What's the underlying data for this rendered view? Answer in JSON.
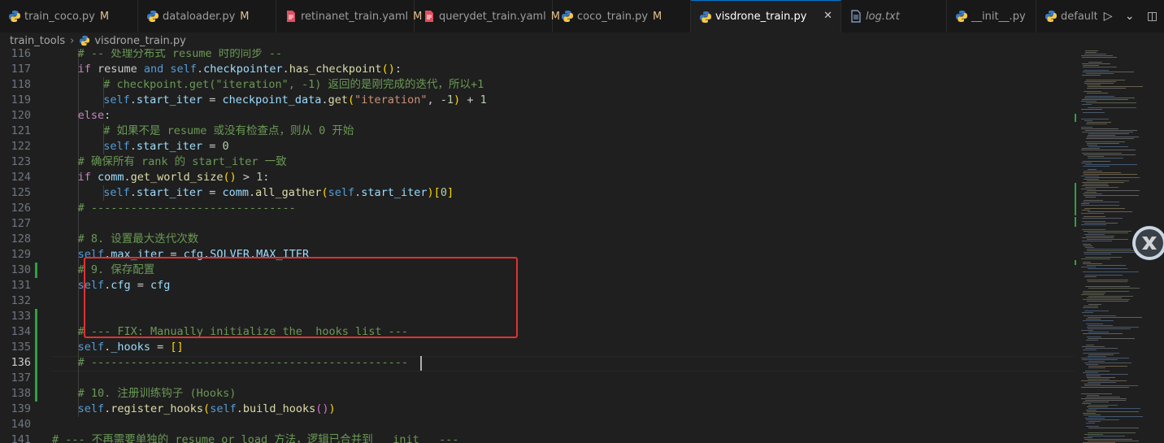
{
  "tabs": [
    {
      "label": "train_coco.py",
      "modified": "M",
      "icon": "python-icon",
      "active": false,
      "italic": false
    },
    {
      "label": "dataloader.py",
      "modified": "M",
      "icon": "python-icon",
      "active": false,
      "italic": false
    },
    {
      "label": "retinanet_train.yaml",
      "modified": "M",
      "icon": "yaml-icon",
      "active": false,
      "italic": false
    },
    {
      "label": "querydet_train.yaml",
      "modified": "M",
      "icon": "yaml-icon",
      "active": false,
      "italic": false
    },
    {
      "label": "coco_train.py",
      "modified": "M",
      "icon": "python-icon",
      "active": false,
      "italic": false
    },
    {
      "label": "visdrone_train.py",
      "modified": "",
      "icon": "python-icon",
      "active": true,
      "italic": false
    },
    {
      "label": "log.txt",
      "modified": "",
      "icon": "text-file-icon",
      "active": false,
      "italic": true
    },
    {
      "label": "__init__.py",
      "modified": "",
      "icon": "python-icon",
      "active": false,
      "italic": false
    },
    {
      "label": "defaults.",
      "modified": "",
      "icon": "python-icon",
      "active": false,
      "italic": false
    }
  ],
  "tab_actions": {
    "run": "▷",
    "run_menu": "⌄",
    "split": "◫"
  },
  "close_glyph": "✕",
  "breadcrumb": {
    "folder": "train_tools",
    "separator": "›",
    "file": "visdrone_train.py"
  },
  "colors": {
    "accent": "#0078d4",
    "modified": "#e2c08d",
    "git_added": "#2ea043",
    "highlight_box": "#e03131"
  },
  "lines": [
    {
      "n": "116",
      "gut": "",
      "tokens": [
        [
          "cm",
          "# -- 处理分布式 resume 时的同步 --"
        ]
      ]
    },
    {
      "n": "117",
      "gut": "",
      "tokens": [
        [
          "ctl",
          "if"
        ],
        [
          "pl",
          " resume "
        ],
        [
          "kw",
          "and"
        ],
        [
          "pl",
          " "
        ],
        [
          "kw",
          "self"
        ],
        [
          "pl",
          "."
        ],
        [
          "var",
          "checkpointer"
        ],
        [
          "pl",
          "."
        ],
        [
          "fn",
          "has_checkpoint"
        ],
        [
          "br1",
          "()"
        ],
        [
          "pl",
          ":"
        ]
      ]
    },
    {
      "n": "118",
      "gut": "",
      "tokens": [
        [
          "cm",
          "# checkpoint.get(\"iteration\", -1) 返回的是刚完成的迭代，所以+1"
        ]
      ]
    },
    {
      "n": "119",
      "gut": "",
      "tokens": [
        [
          "kw",
          "self"
        ],
        [
          "pl",
          "."
        ],
        [
          "var",
          "start_iter"
        ],
        [
          "pl",
          " = "
        ],
        [
          "var",
          "checkpoint_data"
        ],
        [
          "pl",
          "."
        ],
        [
          "fn",
          "get"
        ],
        [
          "br1",
          "("
        ],
        [
          "str",
          "\"iteration\""
        ],
        [
          "pl",
          ", -"
        ],
        [
          "num",
          "1"
        ],
        [
          "br1",
          ")"
        ],
        [
          "pl",
          " + "
        ],
        [
          "num",
          "1"
        ]
      ]
    },
    {
      "n": "120",
      "gut": "",
      "tokens": [
        [
          "ctl",
          "else"
        ],
        [
          "pl",
          ":"
        ]
      ]
    },
    {
      "n": "121",
      "gut": "",
      "tokens": [
        [
          "cm",
          "# 如果不是 resume 或没有检查点，则从 0 开始"
        ]
      ]
    },
    {
      "n": "122",
      "gut": "",
      "tokens": [
        [
          "kw",
          "self"
        ],
        [
          "pl",
          "."
        ],
        [
          "var",
          "start_iter"
        ],
        [
          "pl",
          " = "
        ],
        [
          "num",
          "0"
        ]
      ]
    },
    {
      "n": "123",
      "gut": "",
      "tokens": [
        [
          "cm",
          "# 确保所有 rank 的 start_iter 一致"
        ]
      ]
    },
    {
      "n": "124",
      "gut": "",
      "tokens": [
        [
          "ctl",
          "if"
        ],
        [
          "pl",
          " "
        ],
        [
          "var",
          "comm"
        ],
        [
          "pl",
          "."
        ],
        [
          "fn",
          "get_world_size"
        ],
        [
          "br1",
          "()"
        ],
        [
          "pl",
          " > "
        ],
        [
          "num",
          "1"
        ],
        [
          "pl",
          ":"
        ]
      ]
    },
    {
      "n": "125",
      "gut": "",
      "tokens": [
        [
          "kw",
          "self"
        ],
        [
          "pl",
          "."
        ],
        [
          "var",
          "start_iter"
        ],
        [
          "pl",
          " = "
        ],
        [
          "var",
          "comm"
        ],
        [
          "pl",
          "."
        ],
        [
          "fn",
          "all_gather"
        ],
        [
          "br1",
          "("
        ],
        [
          "kw",
          "self"
        ],
        [
          "pl",
          "."
        ],
        [
          "var",
          "start_iter"
        ],
        [
          "br1",
          ")"
        ],
        [
          "br1",
          "["
        ],
        [
          "num",
          "0"
        ],
        [
          "br1",
          "]"
        ]
      ]
    },
    {
      "n": "126",
      "gut": "",
      "tokens": [
        [
          "cm",
          "# -------------------------------"
        ]
      ]
    },
    {
      "n": "127",
      "gut": "",
      "tokens": []
    },
    {
      "n": "128",
      "gut": "",
      "tokens": [
        [
          "cm",
          "# 8. 设置最大迭代次数"
        ]
      ]
    },
    {
      "n": "129",
      "gut": "",
      "tokens": [
        [
          "kw",
          "self"
        ],
        [
          "pl",
          "."
        ],
        [
          "var",
          "max_iter"
        ],
        [
          "pl",
          " = "
        ],
        [
          "var",
          "cfg"
        ],
        [
          "pl",
          "."
        ],
        [
          "var",
          "SOLVER"
        ],
        [
          "pl",
          "."
        ],
        [
          "var",
          "MAX_ITER"
        ]
      ]
    },
    {
      "n": "130",
      "gut": "add",
      "tokens": [
        [
          "cm",
          "# 9. 保存配置"
        ]
      ]
    },
    {
      "n": "131",
      "gut": "",
      "tokens": [
        [
          "kw",
          "self"
        ],
        [
          "pl",
          "."
        ],
        [
          "var",
          "cfg"
        ],
        [
          "pl",
          " = "
        ],
        [
          "var",
          "cfg"
        ]
      ]
    },
    {
      "n": "132",
      "gut": "",
      "tokens": []
    },
    {
      "n": "133",
      "gut": "add",
      "tokens": []
    },
    {
      "n": "134",
      "gut": "add",
      "tokens": [
        [
          "cm",
          "# --- FIX: Manually initialize the _hooks list ---"
        ]
      ]
    },
    {
      "n": "135",
      "gut": "add",
      "tokens": [
        [
          "kw",
          "self"
        ],
        [
          "pl",
          "."
        ],
        [
          "var",
          "_hooks"
        ],
        [
          "pl",
          " = "
        ],
        [
          "br1",
          "[]"
        ]
      ]
    },
    {
      "n": "136",
      "gut": "add",
      "tokens": [
        [
          "cm",
          "# ------------------------------------------------"
        ]
      ]
    },
    {
      "n": "137",
      "gut": "add",
      "tokens": []
    },
    {
      "n": "138",
      "gut": "add",
      "tokens": [
        [
          "cm",
          "# 10. 注册训练钩子 (Hooks)"
        ]
      ]
    },
    {
      "n": "139",
      "gut": "",
      "tokens": [
        [
          "kw",
          "self"
        ],
        [
          "pl",
          "."
        ],
        [
          "fn",
          "register_hooks"
        ],
        [
          "br1",
          "("
        ],
        [
          "kw",
          "self"
        ],
        [
          "pl",
          "."
        ],
        [
          "fn",
          "build_hooks"
        ],
        [
          "br2",
          "()"
        ],
        [
          "br1",
          ")"
        ]
      ]
    },
    {
      "n": "140",
      "gut": "",
      "tokens": []
    },
    {
      "n": "141",
      "gut": "",
      "tokens": [
        [
          "cm",
          "# --- 不再需要单独的 resume or load 方法，逻辑已合并到 __init__ ---"
        ]
      ]
    }
  ]
}
